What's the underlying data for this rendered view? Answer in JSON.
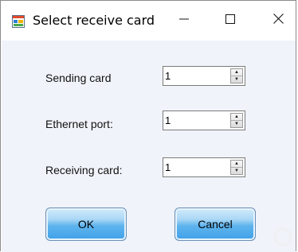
{
  "window": {
    "title": "Select receive card",
    "icon": "app-window-icon",
    "controls": {
      "minimize": "minimize-icon",
      "maximize": "maximize-icon",
      "close": "close-icon"
    }
  },
  "fields": [
    {
      "label": "Sending card",
      "value": "1"
    },
    {
      "label": "Ethernet port:",
      "value": "1"
    },
    {
      "label": "Receiving card:",
      "value": "1"
    }
  ],
  "buttons": {
    "ok": "OK",
    "cancel": "Cancel"
  },
  "colors": {
    "button_blue": "#3ea0e8",
    "client_bg": "#f0f4fa"
  }
}
